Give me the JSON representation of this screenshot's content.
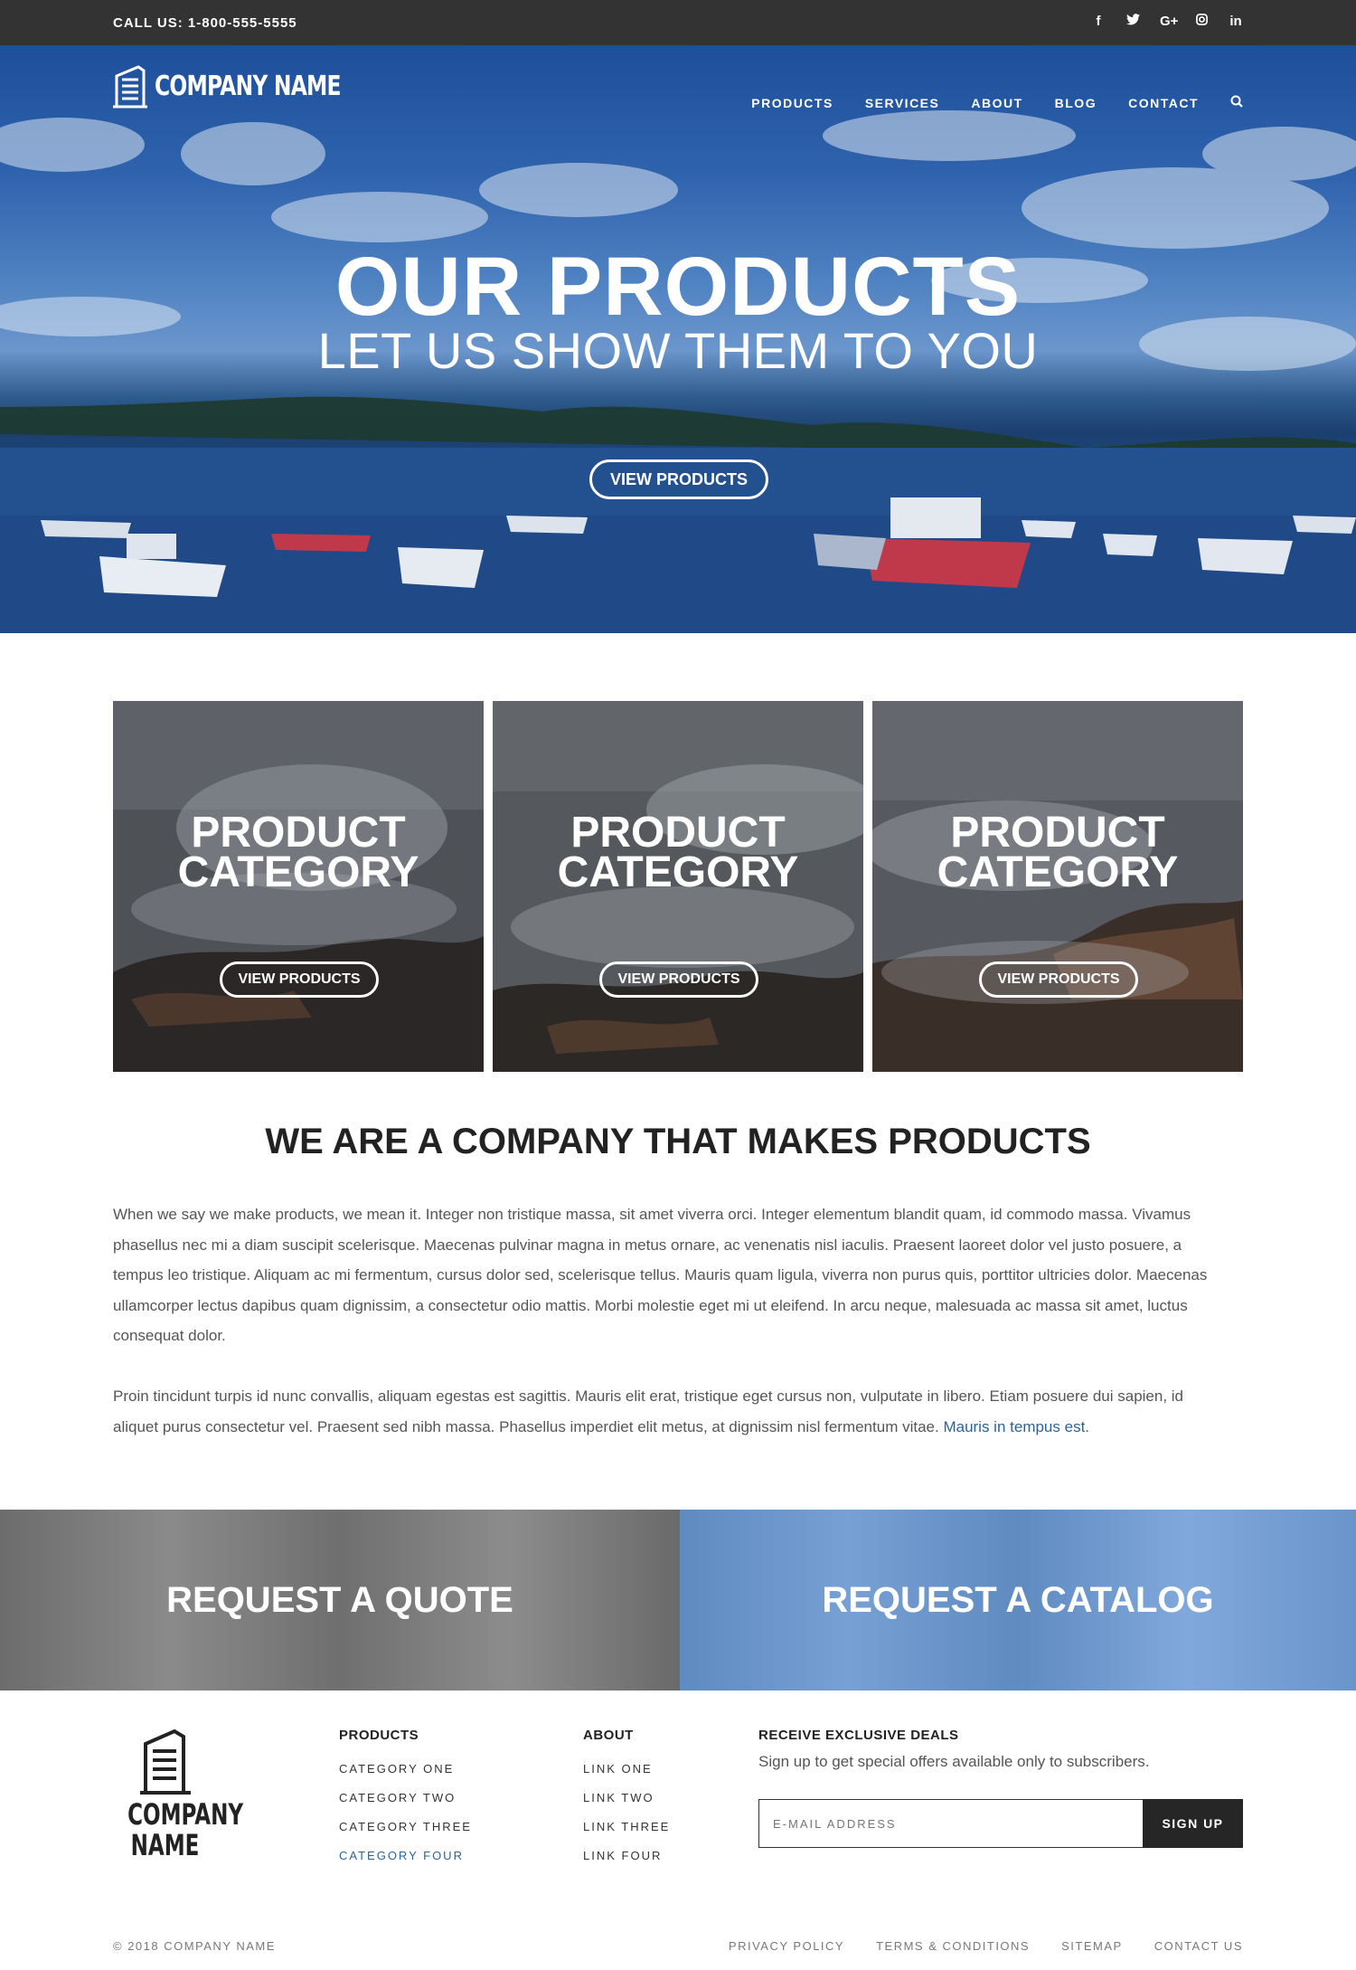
{
  "topbar": {
    "call": "CALL US: 1-800-555-5555",
    "social": [
      {
        "icon": "facebook-icon",
        "glyph": "f"
      },
      {
        "icon": "twitter-icon",
        "glyph": "🐦"
      },
      {
        "icon": "google-plus-icon",
        "glyph": "G+"
      },
      {
        "icon": "instagram-icon",
        "glyph": "◎"
      },
      {
        "icon": "linkedin-icon",
        "glyph": "in"
      }
    ]
  },
  "header": {
    "logo_text": "COMPANY NAME",
    "nav": [
      "PRODUCTS",
      "SERVICES",
      "ABOUT",
      "BLOG",
      "CONTACT"
    ]
  },
  "hero": {
    "title": "OUR PRODUCTS",
    "subtitle": "LET US SHOW THEM TO YOU",
    "button": "VIEW PRODUCTS"
  },
  "categories": [
    {
      "line1": "PRODUCT",
      "line2": "CATEGORY",
      "button": "VIEW PRODUCTS"
    },
    {
      "line1": "PRODUCT",
      "line2": "CATEGORY",
      "button": "VIEW PRODUCTS"
    },
    {
      "line1": "PRODUCT",
      "line2": "CATEGORY",
      "button": "VIEW PRODUCTS"
    }
  ],
  "about": {
    "title": "WE ARE A COMPANY THAT MAKES PRODUCTS",
    "para1": "When we say we make products, we mean it. Integer non tristique massa, sit amet viverra orci. Integer elementum blandit quam, id commodo massa. Vivamus phasellus nec mi a diam suscipit scelerisque. Maecenas pulvinar magna in metus ornare, ac venenatis nisl iaculis. Praesent laoreet dolor vel justo posuere, a tempus leo tristique. Aliquam ac mi fermentum, cursus dolor sed, scelerisque tellus. Mauris quam ligula, viverra non purus quis, porttitor ultricies dolor. Maecenas ullamcorper lectus dapibus quam dignissim, a consectetur odio mattis. Morbi molestie eget mi ut eleifend. In arcu neque, malesuada ac massa sit amet, luctus consequat dolor.",
    "para2": "Proin tincidunt turpis id nunc convallis, aliquam egestas est sagittis. Mauris elit erat, tristique eget cursus non, vulputate in libero. Etiam posuere dui sapien, id aliquet purus consectetur vel. Praesent sed nibh massa. Phasellus imperdiet elit metus, at dignissim nisl fermentum vitae.",
    "para2_link": "Mauris in tempus est."
  },
  "cta": {
    "quote": "REQUEST A QUOTE",
    "catalog": "REQUEST A CATALOG"
  },
  "footer": {
    "logo_line1": "COMPANY",
    "logo_line2": "NAME",
    "products": {
      "heading": "PRODUCTS",
      "links": [
        "CATEGORY ONE",
        "CATEGORY TWO",
        "CATEGORY THREE",
        "CATEGORY FOUR"
      ]
    },
    "about": {
      "heading": "ABOUT",
      "links": [
        "LINK ONE",
        "LINK TWO",
        "LINK THREE",
        "LINK FOUR"
      ]
    },
    "deals": {
      "heading": "RECEIVE EXCLUSIVE DEALS",
      "text": "Sign up to get special offers available only to subscribers.",
      "placeholder": "E-MAIL ADDRESS",
      "button": "SIGN UP"
    },
    "copyright": "© 2018 COMPANY NAME",
    "legal": [
      "PRIVACY POLICY",
      "TERMS & CONDITIONS",
      "SITEMAP",
      "CONTACT US"
    ]
  },
  "colors": {
    "topbar": "#333333",
    "link_accent": "#2a6496",
    "cta_quote": "#7a7a7a",
    "cta_catalog": "#6a95cb",
    "signup_button": "#262626"
  }
}
